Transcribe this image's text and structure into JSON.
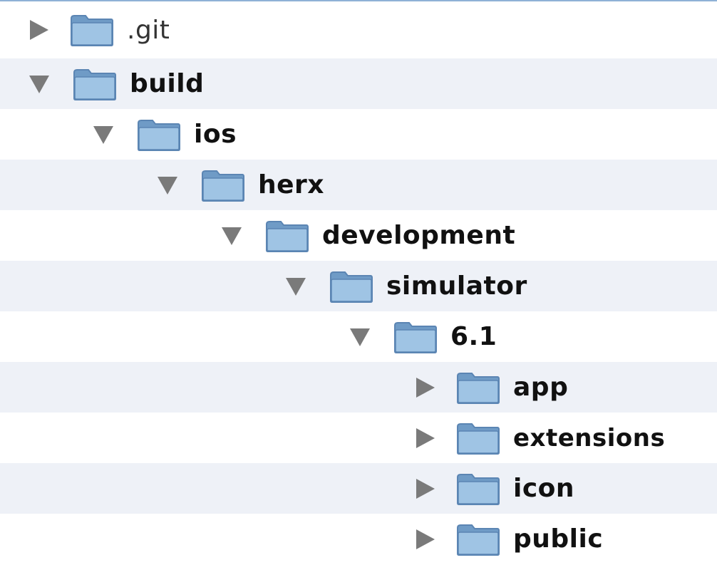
{
  "tree": {
    "items": [
      {
        "label": ".git",
        "depth": 0,
        "expanded": false,
        "icon": "folder-icon"
      },
      {
        "label": "build",
        "depth": 0,
        "expanded": true,
        "icon": "folder-icon"
      },
      {
        "label": "ios",
        "depth": 1,
        "expanded": true,
        "icon": "folder-icon"
      },
      {
        "label": "herx",
        "depth": 2,
        "expanded": true,
        "icon": "folder-icon"
      },
      {
        "label": "development",
        "depth": 3,
        "expanded": true,
        "icon": "folder-icon"
      },
      {
        "label": "simulator",
        "depth": 4,
        "expanded": true,
        "icon": "folder-icon"
      },
      {
        "label": "6.1",
        "depth": 5,
        "expanded": true,
        "icon": "folder-icon"
      },
      {
        "label": "app",
        "depth": 6,
        "expanded": false,
        "icon": "folder-icon"
      },
      {
        "label": "extensions",
        "depth": 6,
        "expanded": false,
        "icon": "folder-icon"
      },
      {
        "label": "icon",
        "depth": 6,
        "expanded": false,
        "icon": "folder-icon"
      },
      {
        "label": "public",
        "depth": 6,
        "expanded": false,
        "icon": "folder-icon"
      }
    ]
  },
  "colors": {
    "row_alt": "#eef1f7",
    "triangle": "#7a7a7a",
    "folder_fill": "#8fb8dc",
    "folder_border": "#5b85b3",
    "top_border": "#8fb1d6"
  }
}
